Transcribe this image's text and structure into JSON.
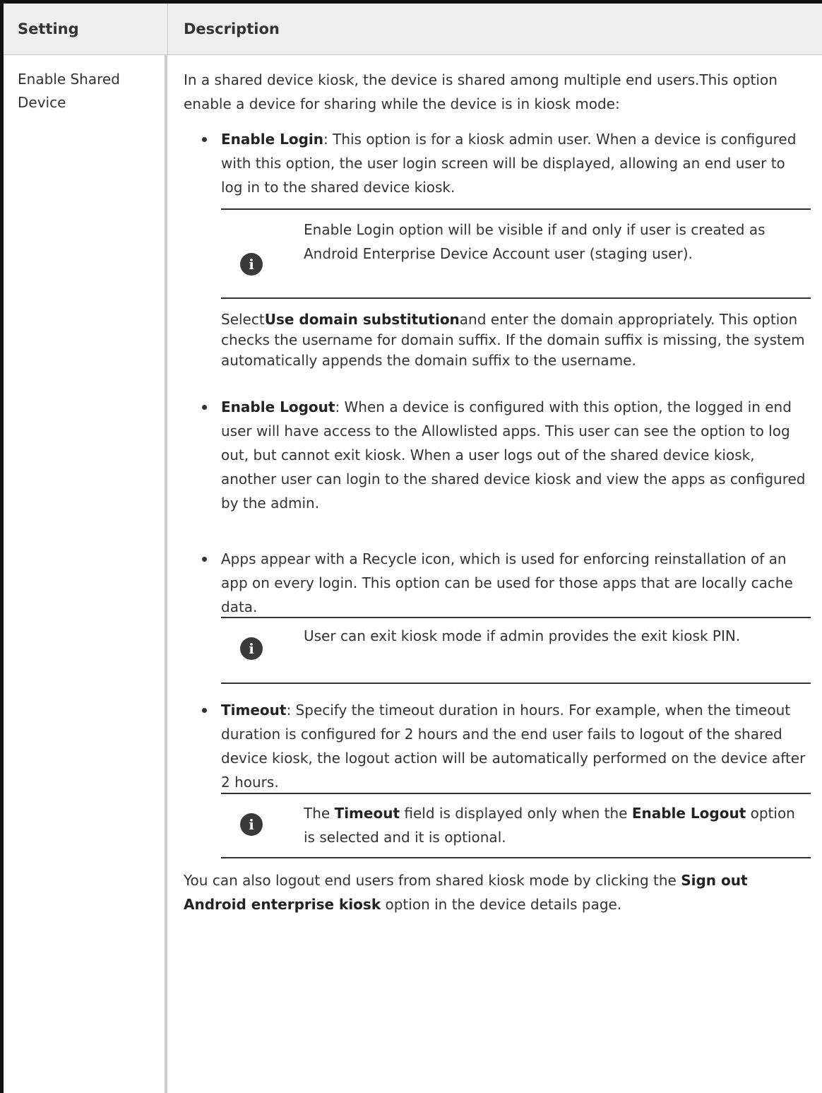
{
  "table": {
    "header": {
      "setting": "Setting",
      "description": "Description"
    },
    "row": {
      "setting": "Enable Shared Device",
      "intro": "In a shared device kiosk, the device is shared among multiple end users.This option enable a device for sharing while the device is in kiosk mode:",
      "login": {
        "term": "Enable Login",
        "text": ": This option is for a kiosk admin user. When a device is configured with this option, the user login screen will be displayed, allowing an end user to log in to the shared device kiosk.",
        "note": "Enable Login option will be visible if and only if user is created as Android Enterprise Device Account user (staging user).",
        "domain_prefix": "Select",
        "domain_term": "Use domain substitution",
        "domain_rest": "and enter the domain appropriately.  This option checks the username for domain suffix. If the domain suffix is missing, the system automatically appends the domain suffix to the username."
      },
      "logout": {
        "term": "Enable Logout",
        "text": ": When a device is configured with this option, the logged in end user will have access to the Allowlisted apps. This user can see the option to log out, but cannot exit kiosk. When a user logs out of the shared device kiosk, another user can login to the shared device kiosk and view the apps as configured by the admin."
      },
      "recycle": {
        "text": "Apps appear with a Recycle icon, which is used for enforcing reinstallation of an app on every login. This option can be used for those apps that are locally cache data.",
        "note": "User can exit kiosk mode if admin provides the exit kiosk PIN."
      },
      "timeout": {
        "term": "Timeout",
        "text": ": Specify the timeout duration in hours. For example, when the timeout duration is configured for 2 hours and the end user fails to logout of the shared device kiosk, the logout action will be automatically performed on the device after 2 hours.",
        "note_pre": "The ",
        "note_term1": "Timeout",
        "note_mid": " field is displayed only when the ",
        "note_term2": "Enable Logout",
        "note_post": " option is selected and it is optional."
      },
      "signout": {
        "pre": "You can also logout end users from shared kiosk mode by clicking the ",
        "term": "Sign out Android enterprise kiosk",
        "post": " option in the device details page."
      },
      "info_icon": "i"
    }
  }
}
